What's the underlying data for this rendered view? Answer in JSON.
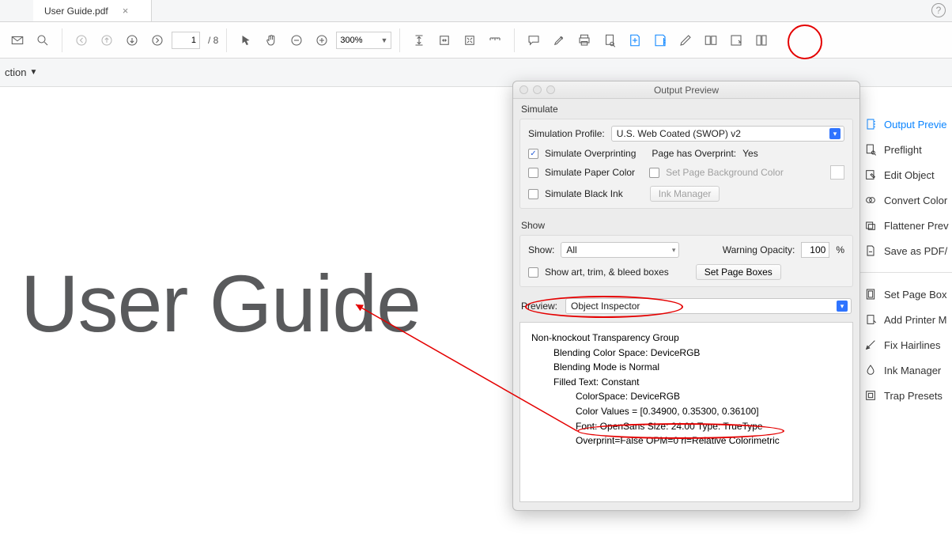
{
  "tab": {
    "title": "User Guide.pdf"
  },
  "toolbar": {
    "page_current": "1",
    "page_total": "8",
    "zoom": "300%"
  },
  "subbar": {
    "fragment": "ction"
  },
  "document": {
    "big_heading": "User Guide"
  },
  "right_tools": {
    "items": [
      {
        "label": "Output Previe"
      },
      {
        "label": "Preflight"
      },
      {
        "label": "Edit Object"
      },
      {
        "label": "Convert Color"
      },
      {
        "label": "Flattener Prev"
      },
      {
        "label": "Save as PDF/"
      },
      {
        "label": "Set Page Box"
      },
      {
        "label": "Add Printer M"
      },
      {
        "label": "Fix Hairlines"
      },
      {
        "label": "Ink Manager"
      },
      {
        "label": "Trap Presets"
      }
    ]
  },
  "panel": {
    "title": "Output Preview",
    "simulate_heading": "Simulate",
    "sim_profile_label": "Simulation Profile:",
    "sim_profile_value": "U.S. Web Coated (SWOP) v2",
    "sim_overprint_label": "Simulate Overprinting",
    "page_has_op_label": "Page has Overprint:",
    "page_has_op_value": "Yes",
    "sim_paper_label": "Simulate Paper Color",
    "set_bg_label": "Set Page Background Color",
    "sim_black_label": "Simulate Black Ink",
    "ink_manager_btn": "Ink Manager",
    "show_heading": "Show",
    "show_label": "Show:",
    "show_value": "All",
    "warning_label": "Warning Opacity:",
    "warning_value": "100",
    "warning_unit": "%",
    "show_art_label": "Show art, trim, & bleed boxes",
    "set_page_boxes_btn": "Set Page Boxes",
    "preview_label": "Preview:",
    "preview_value": "Object Inspector",
    "inspector": {
      "l1": "Non-knockout Transparency Group",
      "l2": "Blending Color Space: DeviceRGB",
      "l3": "Blending Mode is Normal",
      "l4": "Filled Text: Constant",
      "l5": "ColorSpace: DeviceRGB",
      "l6": "Color Values = [0.34900, 0.35300, 0.36100]",
      "l7": "Font: OpenSans Size: 24.00 Type: TrueType",
      "l8": "Overprint=False OPM=0 ri=Relative Colorimetric"
    }
  }
}
